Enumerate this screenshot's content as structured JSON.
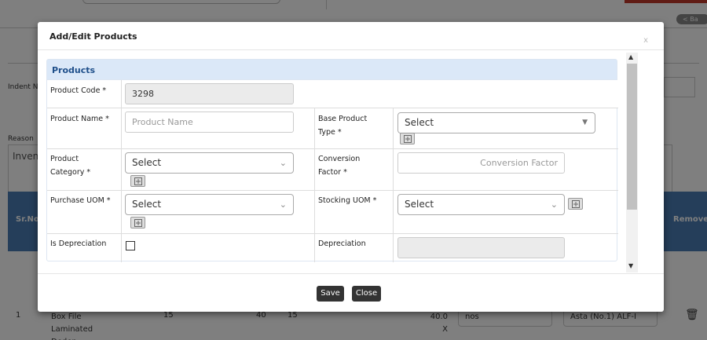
{
  "background": {
    "back_label": "< Ba",
    "indent_label": "Indent N",
    "reason_label": "Reason",
    "inventory_text": "Inven",
    "table_headers": {
      "sr_no": "Sr.No",
      "remove": "Remove"
    },
    "row": {
      "sr": "1",
      "product": "Box File Laminated Deden",
      "qty1": "15",
      "qty2": "40",
      "qty3": "15",
      "factor": "40.0 X",
      "uom": "nos",
      "asset": "Asta (No.1) ALF-I"
    }
  },
  "modal": {
    "title": "Add/Edit Products",
    "close_label": "x",
    "panel_title": "Products",
    "fields": {
      "product_code": {
        "label": "Product Code *",
        "value": "3298"
      },
      "product_name": {
        "label": "Product Name *",
        "placeholder": "Product Name"
      },
      "base_product_type": {
        "label": "Base Product Type *",
        "value": "Select"
      },
      "product_category": {
        "label": "Product Category *",
        "value": "Select"
      },
      "conversion_factor": {
        "label": "Conversion Factor *",
        "placeholder": "Conversion Factor"
      },
      "purchase_uom": {
        "label": "Purchase UOM *",
        "value": "Select"
      },
      "stocking_uom": {
        "label": "Stocking UOM *",
        "value": "Select"
      },
      "is_depreciation": {
        "label": "Is Depreciation",
        "checked": false
      },
      "depreciation": {
        "label": "Depreciation",
        "value": ""
      }
    },
    "buttons": {
      "save": "Save",
      "close": "Close"
    }
  },
  "colors": {
    "panel_header_bg": "#dbe8f8",
    "panel_title": "#1f4f8a",
    "button_bg": "#333333",
    "table_header": "#4a7db5"
  }
}
